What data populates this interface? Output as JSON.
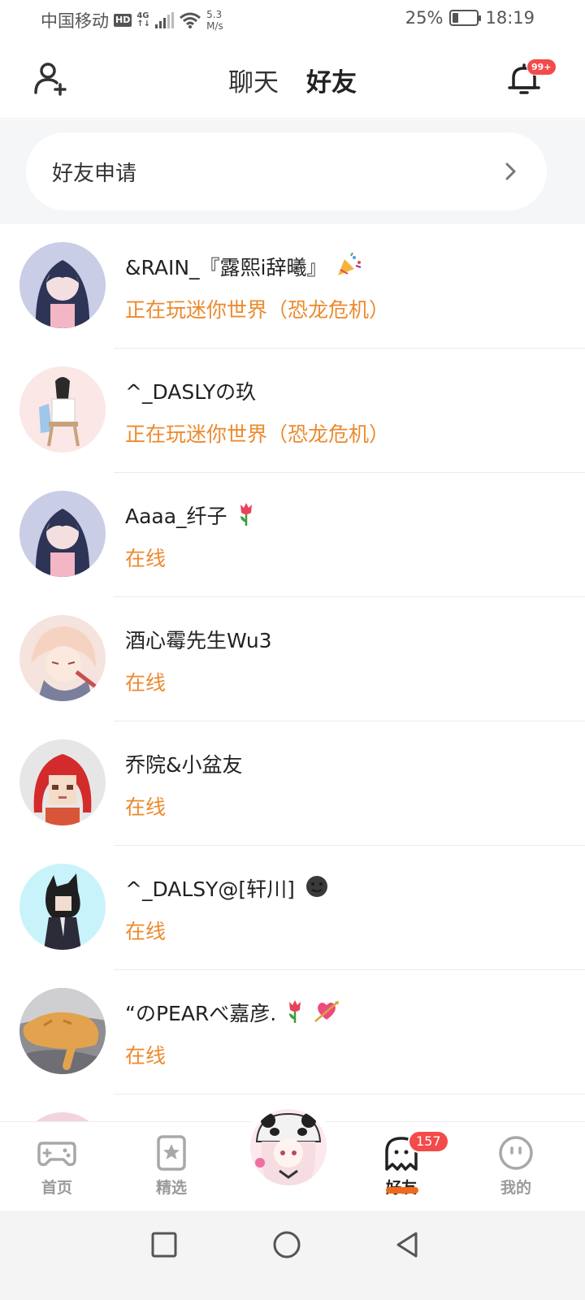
{
  "status_bar": {
    "carrier": "中国移动",
    "hd": "HD",
    "network_top": "4G",
    "network_bottom": "↑↓",
    "speed_value": "5.3",
    "speed_unit": "M/s",
    "battery_percent": "25%",
    "battery_level": 0.25,
    "time": "18:19"
  },
  "header": {
    "tabs": [
      {
        "label": "聊天",
        "active": false
      },
      {
        "label": "好友",
        "active": true
      }
    ],
    "notification_badge": "99+",
    "accent_color": "#f06a1e"
  },
  "friend_request": {
    "label": "好友申请"
  },
  "friends": [
    {
      "nickname": "&RAIN_『露熙i辞曦』",
      "emoji": "party-popper",
      "status": "正在玩迷你世界（恐龙危机）",
      "avatar": "anime-girl-dark-hair"
    },
    {
      "nickname": "^_DASLYの玖",
      "emoji": "",
      "status": "正在玩迷你世界（恐龙危机）",
      "avatar": "anime-girl-chair"
    },
    {
      "nickname": "Aaaa_纤子",
      "emoji": "tulip",
      "status": "在线",
      "avatar": "anime-girl-dark-hair"
    },
    {
      "nickname": "酒心霉先生Wu3",
      "emoji": "",
      "status": "在线",
      "avatar": "anime-boy-light-hair"
    },
    {
      "nickname": "乔院&小盆友",
      "emoji": "",
      "status": "在线",
      "avatar": "pixel-girl-red-hair"
    },
    {
      "nickname": "^_DALSY@[轩川]",
      "emoji": "dark-moon-face",
      "status": "在线",
      "avatar": "character-black-hair"
    },
    {
      "nickname": "“のPEARべ嘉彦.",
      "emoji": "tulip heart-arrow",
      "status": "在线",
      "avatar": "orange-cat"
    }
  ],
  "status_color": "#ec8a2e",
  "bottom_nav": {
    "items": [
      {
        "label": "首页",
        "icon": "gamepad-icon",
        "active": false
      },
      {
        "label": "精选",
        "icon": "star-card-icon",
        "active": false
      },
      {
        "label": "好友",
        "icon": "ghost-icon",
        "active": true,
        "badge": "157"
      },
      {
        "label": "我的",
        "icon": "smiley-icon",
        "active": false
      }
    ]
  }
}
